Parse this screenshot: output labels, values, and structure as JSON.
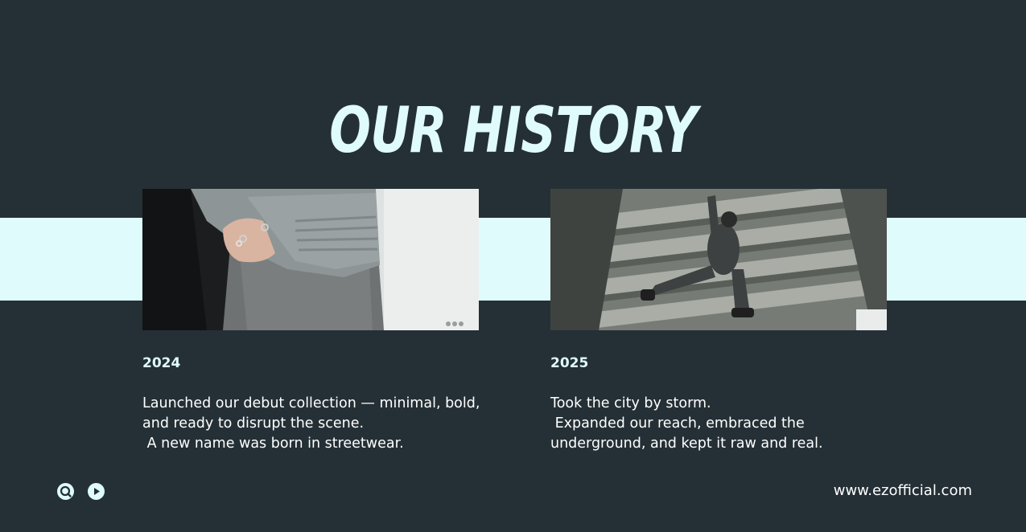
{
  "title": "OUR HISTORY",
  "entries": [
    {
      "year": "2024",
      "lines": [
        "Launched our debut collection — minimal, bold,",
        "and ready to disrupt the scene.",
        " A new name was born in streetwear."
      ]
    },
    {
      "year": "2025",
      "lines": [
        "Took the city by storm.",
        " Expanded our reach, embraced the",
        "underground, and kept it raw and real."
      ]
    }
  ],
  "footer": {
    "website": "www.ezofficial.com",
    "icons": [
      "search-icon",
      "play-icon"
    ]
  },
  "colors": {
    "background": "#243036",
    "accent": "#e0fbfc",
    "text": "#ffffff"
  }
}
